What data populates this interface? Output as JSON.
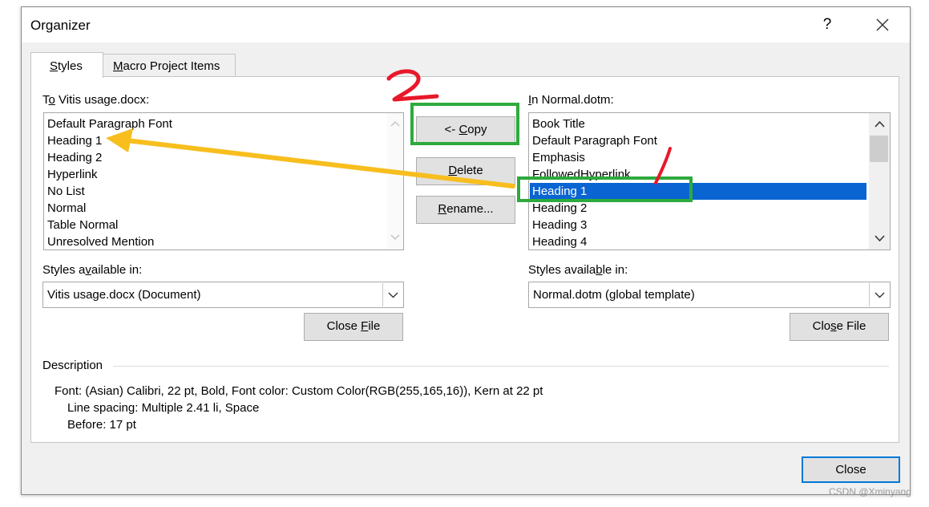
{
  "window": {
    "title": "Organizer",
    "help_label": "?"
  },
  "tabs": [
    {
      "label": "Styles",
      "mnemonic": "S",
      "rest": "tyles",
      "active": true
    },
    {
      "label": "Macro Project Items",
      "mnemonic": "M",
      "rest": "acro Project Items",
      "active": false
    }
  ],
  "left": {
    "label_prefix": "T",
    "label_mnemonic": "o",
    "label_rest": " Vitis usage.docx:",
    "items": [
      "Default Paragraph Font",
      "Heading 1",
      "Heading 2",
      "Hyperlink",
      "No List",
      "Normal",
      "Table Normal",
      "Unresolved Mention"
    ],
    "available_label": {
      "pre": "Styles a",
      "mn": "v",
      "post": "ailable in:"
    },
    "available_value": "Vitis usage.docx (Document)",
    "close_file": {
      "pre": "Close ",
      "mn": "F",
      "post": "ile"
    }
  },
  "middle": {
    "copy": {
      "pre": "<- ",
      "mn": "C",
      "post": "opy"
    },
    "delete": {
      "pre": "",
      "mn": "D",
      "post": "elete"
    },
    "rename": {
      "pre": "",
      "mn": "R",
      "post": "ename..."
    }
  },
  "right": {
    "label_mnemonic": "I",
    "label_rest": "n Normal.dotm:",
    "items": [
      "Book Title",
      "Default Paragraph Font",
      "Emphasis",
      "FollowedHyperlink",
      "Heading 1",
      "Heading 2",
      "Heading 3",
      "Heading 4"
    ],
    "selected_index": 4,
    "available_label": {
      "pre": "Styles availa",
      "mn": "b",
      "post": "le in:"
    },
    "available_value": "Normal.dotm (global template)",
    "close_file": {
      "pre": "Clo",
      "mn": "s",
      "post": "e File"
    }
  },
  "description": {
    "heading": "Description",
    "lines": [
      "Font: (Asian) Calibri, 22 pt, Bold, Font color: Custom Color(RGB(255,165,16)), Kern at 22 pt",
      "Line spacing:  Multiple 2.41 li, Space",
      "Before:  17 pt"
    ]
  },
  "footer": {
    "close_label": "Close"
  },
  "annotations": {
    "marker_1": "1",
    "marker_2": "2",
    "arrow_color": "#f7be1e",
    "box_color": "#2eaa3c",
    "marker_color": "#e8182a"
  },
  "watermark": "CSDN @Xminyang",
  "colors": {
    "selection": "#0a64d2",
    "dialog_bg": "#f0f0f0",
    "default_button_border": "#0078d7"
  }
}
